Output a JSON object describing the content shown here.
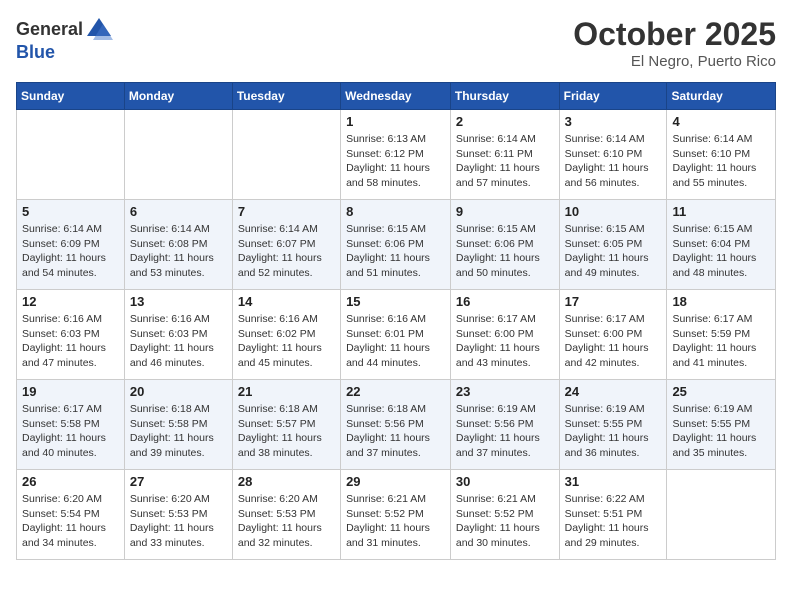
{
  "header": {
    "logo_line1": "General",
    "logo_line2": "Blue",
    "month": "October 2025",
    "location": "El Negro, Puerto Rico"
  },
  "weekdays": [
    "Sunday",
    "Monday",
    "Tuesday",
    "Wednesday",
    "Thursday",
    "Friday",
    "Saturday"
  ],
  "weeks": [
    [
      {
        "day": "",
        "info": ""
      },
      {
        "day": "",
        "info": ""
      },
      {
        "day": "",
        "info": ""
      },
      {
        "day": "1",
        "info": "Sunrise: 6:13 AM\nSunset: 6:12 PM\nDaylight: 11 hours\nand 58 minutes."
      },
      {
        "day": "2",
        "info": "Sunrise: 6:14 AM\nSunset: 6:11 PM\nDaylight: 11 hours\nand 57 minutes."
      },
      {
        "day": "3",
        "info": "Sunrise: 6:14 AM\nSunset: 6:10 PM\nDaylight: 11 hours\nand 56 minutes."
      },
      {
        "day": "4",
        "info": "Sunrise: 6:14 AM\nSunset: 6:10 PM\nDaylight: 11 hours\nand 55 minutes."
      }
    ],
    [
      {
        "day": "5",
        "info": "Sunrise: 6:14 AM\nSunset: 6:09 PM\nDaylight: 11 hours\nand 54 minutes."
      },
      {
        "day": "6",
        "info": "Sunrise: 6:14 AM\nSunset: 6:08 PM\nDaylight: 11 hours\nand 53 minutes."
      },
      {
        "day": "7",
        "info": "Sunrise: 6:14 AM\nSunset: 6:07 PM\nDaylight: 11 hours\nand 52 minutes."
      },
      {
        "day": "8",
        "info": "Sunrise: 6:15 AM\nSunset: 6:06 PM\nDaylight: 11 hours\nand 51 minutes."
      },
      {
        "day": "9",
        "info": "Sunrise: 6:15 AM\nSunset: 6:06 PM\nDaylight: 11 hours\nand 50 minutes."
      },
      {
        "day": "10",
        "info": "Sunrise: 6:15 AM\nSunset: 6:05 PM\nDaylight: 11 hours\nand 49 minutes."
      },
      {
        "day": "11",
        "info": "Sunrise: 6:15 AM\nSunset: 6:04 PM\nDaylight: 11 hours\nand 48 minutes."
      }
    ],
    [
      {
        "day": "12",
        "info": "Sunrise: 6:16 AM\nSunset: 6:03 PM\nDaylight: 11 hours\nand 47 minutes."
      },
      {
        "day": "13",
        "info": "Sunrise: 6:16 AM\nSunset: 6:03 PM\nDaylight: 11 hours\nand 46 minutes."
      },
      {
        "day": "14",
        "info": "Sunrise: 6:16 AM\nSunset: 6:02 PM\nDaylight: 11 hours\nand 45 minutes."
      },
      {
        "day": "15",
        "info": "Sunrise: 6:16 AM\nSunset: 6:01 PM\nDaylight: 11 hours\nand 44 minutes."
      },
      {
        "day": "16",
        "info": "Sunrise: 6:17 AM\nSunset: 6:00 PM\nDaylight: 11 hours\nand 43 minutes."
      },
      {
        "day": "17",
        "info": "Sunrise: 6:17 AM\nSunset: 6:00 PM\nDaylight: 11 hours\nand 42 minutes."
      },
      {
        "day": "18",
        "info": "Sunrise: 6:17 AM\nSunset: 5:59 PM\nDaylight: 11 hours\nand 41 minutes."
      }
    ],
    [
      {
        "day": "19",
        "info": "Sunrise: 6:17 AM\nSunset: 5:58 PM\nDaylight: 11 hours\nand 40 minutes."
      },
      {
        "day": "20",
        "info": "Sunrise: 6:18 AM\nSunset: 5:58 PM\nDaylight: 11 hours\nand 39 minutes."
      },
      {
        "day": "21",
        "info": "Sunrise: 6:18 AM\nSunset: 5:57 PM\nDaylight: 11 hours\nand 38 minutes."
      },
      {
        "day": "22",
        "info": "Sunrise: 6:18 AM\nSunset: 5:56 PM\nDaylight: 11 hours\nand 37 minutes."
      },
      {
        "day": "23",
        "info": "Sunrise: 6:19 AM\nSunset: 5:56 PM\nDaylight: 11 hours\nand 37 minutes."
      },
      {
        "day": "24",
        "info": "Sunrise: 6:19 AM\nSunset: 5:55 PM\nDaylight: 11 hours\nand 36 minutes."
      },
      {
        "day": "25",
        "info": "Sunrise: 6:19 AM\nSunset: 5:55 PM\nDaylight: 11 hours\nand 35 minutes."
      }
    ],
    [
      {
        "day": "26",
        "info": "Sunrise: 6:20 AM\nSunset: 5:54 PM\nDaylight: 11 hours\nand 34 minutes."
      },
      {
        "day": "27",
        "info": "Sunrise: 6:20 AM\nSunset: 5:53 PM\nDaylight: 11 hours\nand 33 minutes."
      },
      {
        "day": "28",
        "info": "Sunrise: 6:20 AM\nSunset: 5:53 PM\nDaylight: 11 hours\nand 32 minutes."
      },
      {
        "day": "29",
        "info": "Sunrise: 6:21 AM\nSunset: 5:52 PM\nDaylight: 11 hours\nand 31 minutes."
      },
      {
        "day": "30",
        "info": "Sunrise: 6:21 AM\nSunset: 5:52 PM\nDaylight: 11 hours\nand 30 minutes."
      },
      {
        "day": "31",
        "info": "Sunrise: 6:22 AM\nSunset: 5:51 PM\nDaylight: 11 hours\nand 29 minutes."
      },
      {
        "day": "",
        "info": ""
      }
    ]
  ]
}
